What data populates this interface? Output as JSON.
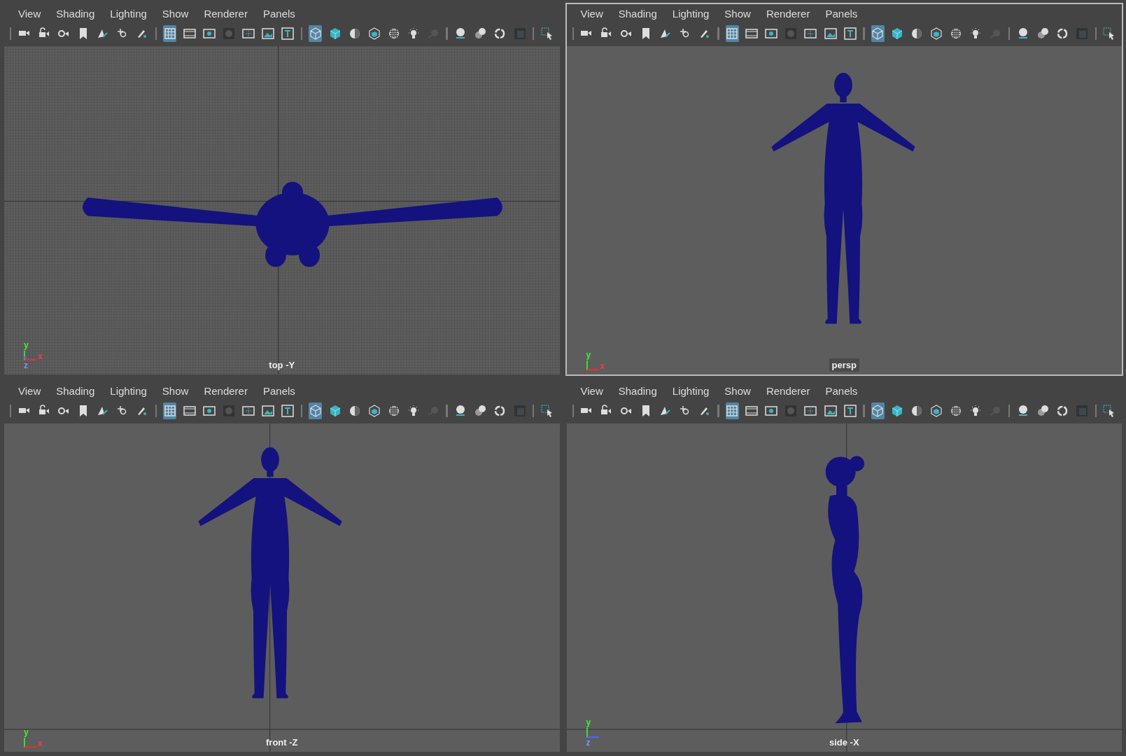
{
  "panels": [
    {
      "menu": [
        "View",
        "Shading",
        "Lighting",
        "Show",
        "Renderer",
        "Panels"
      ],
      "kind": "top",
      "active": false,
      "grid_on": true,
      "wireframe_on": true,
      "axis": [
        {
          "kind": "y",
          "label": "y"
        },
        {
          "kind": "x",
          "label": "x"
        },
        {
          "kind": "z",
          "label": "z"
        }
      ],
      "camera": "top -Y"
    },
    {
      "menu": [
        "View",
        "Shading",
        "Lighting",
        "Show",
        "Renderer",
        "Panels"
      ],
      "kind": "persp",
      "active": true,
      "grid_on": true,
      "wireframe_on": true,
      "axis": [
        {
          "kind": "y",
          "label": "y"
        },
        {
          "kind": "x",
          "label": "x"
        }
      ],
      "camera": "persp"
    },
    {
      "menu": [
        "View",
        "Shading",
        "Lighting",
        "Show",
        "Renderer",
        "Panels"
      ],
      "kind": "front",
      "active": false,
      "grid_on": true,
      "wireframe_on": true,
      "axis": [
        {
          "kind": "y",
          "label": "y"
        },
        {
          "kind": "x",
          "label": "x"
        }
      ],
      "camera": "front -Z"
    },
    {
      "menu": [
        "View",
        "Shading",
        "Lighting",
        "Show",
        "Renderer",
        "Panels"
      ],
      "kind": "side",
      "active": false,
      "grid_on": true,
      "wireframe_on": true,
      "axis": [
        {
          "kind": "y",
          "label": "y"
        },
        {
          "kind": "z",
          "label": "z"
        }
      ],
      "camera": "side -X"
    }
  ]
}
